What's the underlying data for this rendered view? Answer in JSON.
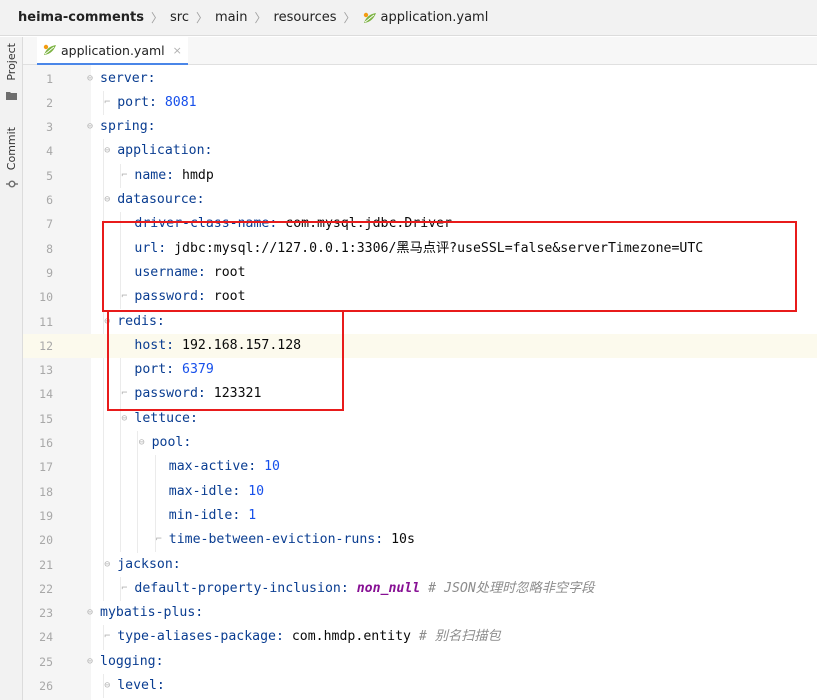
{
  "breadcrumb": {
    "project": "heima-comments",
    "src": "src",
    "main": "main",
    "resources": "resources",
    "file": "application.yaml"
  },
  "toolwindows": {
    "project": "Project",
    "commit": "Commit"
  },
  "tab": {
    "label": "application.yaml",
    "close": "×"
  },
  "editor": {
    "current_line": 12,
    "lines": [
      {
        "n": "1",
        "indent": 0,
        "key": "server:"
      },
      {
        "n": "2",
        "indent": 1,
        "key": "port: ",
        "val": "8081",
        "vt": "n"
      },
      {
        "n": "3",
        "indent": 0,
        "key": "spring:"
      },
      {
        "n": "4",
        "indent": 1,
        "key": "application:"
      },
      {
        "n": "5",
        "indent": 2,
        "key": "name: ",
        "val": "hmdp",
        "vt": "v"
      },
      {
        "n": "6",
        "indent": 1,
        "key": "datasource:"
      },
      {
        "n": "7",
        "indent": 2,
        "key": "driver-class-name: ",
        "val": "com.mysql.jdbc.Driver",
        "vt": "v"
      },
      {
        "n": "8",
        "indent": 2,
        "key": "url: ",
        "val": "jdbc:mysql://127.0.0.1:3306/黑马点评?useSSL=false&serverTimezone=UTC",
        "vt": "v"
      },
      {
        "n": "9",
        "indent": 2,
        "key": "username: ",
        "val": "root",
        "vt": "v"
      },
      {
        "n": "10",
        "indent": 2,
        "key": "password: ",
        "val": "root",
        "vt": "v"
      },
      {
        "n": "11",
        "indent": 1,
        "key": "redis:"
      },
      {
        "n": "12",
        "indent": 2,
        "key": "host: ",
        "val": "192.168.157.128",
        "vt": "v"
      },
      {
        "n": "13",
        "indent": 2,
        "key": "port: ",
        "val": "6379",
        "vt": "n"
      },
      {
        "n": "14",
        "indent": 2,
        "key": "password: ",
        "val": "123321",
        "vt": "v"
      },
      {
        "n": "15",
        "indent": 2,
        "key": "lettuce:"
      },
      {
        "n": "16",
        "indent": 3,
        "key": "pool:"
      },
      {
        "n": "17",
        "indent": 4,
        "key": "max-active: ",
        "val": "10",
        "vt": "n"
      },
      {
        "n": "18",
        "indent": 4,
        "key": "max-idle: ",
        "val": "10",
        "vt": "n"
      },
      {
        "n": "19",
        "indent": 4,
        "key": "min-idle: ",
        "val": "1",
        "vt": "n"
      },
      {
        "n": "20",
        "indent": 4,
        "key": "time-between-eviction-runs: ",
        "val": "10s",
        "vt": "v"
      },
      {
        "n": "21",
        "indent": 1,
        "key": "jackson:"
      },
      {
        "n": "22",
        "indent": 2,
        "key": "default-property-inclusion: ",
        "val": "non_null",
        "vt": "it",
        "comment": "# JSON处理时忽略非空字段"
      },
      {
        "n": "23",
        "indent": 0,
        "key": "mybatis-plus:"
      },
      {
        "n": "24",
        "indent": 1,
        "key": "type-aliases-package: ",
        "val": "com.hmdp.entity",
        "vt": "v",
        "comment": "# 别名扫描包"
      },
      {
        "n": "25",
        "indent": 0,
        "key": "logging:"
      },
      {
        "n": "26",
        "indent": 1,
        "key": "level:"
      }
    ]
  },
  "colors": {
    "highlight_box": "#e81b1b",
    "yaml_key": "#0a3d91",
    "number": "#1750eb"
  }
}
